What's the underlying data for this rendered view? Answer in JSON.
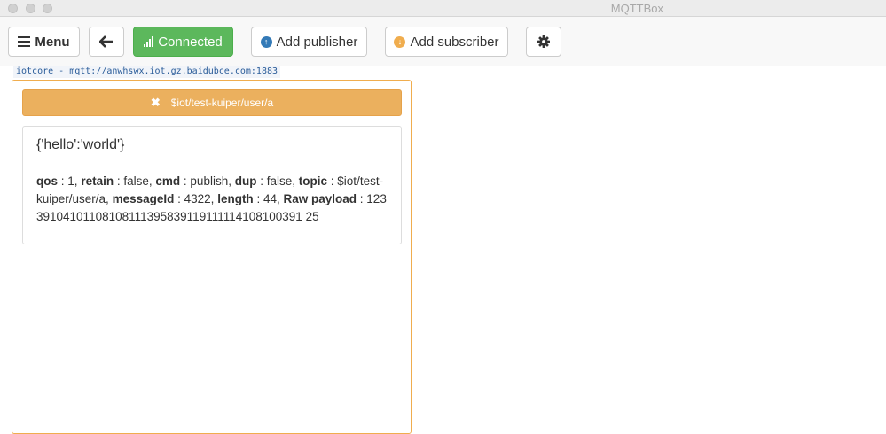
{
  "window": {
    "title": "MQTTBox"
  },
  "toolbar": {
    "menu_label": "Menu",
    "connected_label": "Connected",
    "add_publisher_label": "Add publisher",
    "add_subscriber_label": "Add subscriber"
  },
  "connection": {
    "label": "iotcore - mqtt://anwhswx.iot.gz.baidubce.com:1883"
  },
  "subscriber": {
    "topic": "$iot/test-kuiper/user/a",
    "message": {
      "payload": "{'hello':'world'}",
      "fields": [
        {
          "key": "qos",
          "value": "1"
        },
        {
          "key": "retain",
          "value": "false"
        },
        {
          "key": "cmd",
          "value": "publish"
        },
        {
          "key": "dup",
          "value": "false"
        },
        {
          "key": "topic",
          "value": "$iot/test-kuiper/user/a"
        },
        {
          "key": "messageId",
          "value": "4322"
        },
        {
          "key": "length",
          "value": "44"
        },
        {
          "key": "Raw payload",
          "value": "12339104101108108111395839119111114108100391 25"
        }
      ]
    }
  },
  "colors": {
    "connected": "#5cb85c",
    "topic_bar": "#ebb05e",
    "panel_border": "#f0ad4e",
    "publisher_icon": "#337ab7",
    "subscriber_icon": "#f0ad4e"
  },
  "icons": {
    "menu": "hamburger-icon",
    "back": "arrow-left-icon",
    "connected": "signal-icon",
    "add_publisher": "arrow-circle-up-icon",
    "add_subscriber": "arrow-circle-down-icon",
    "settings": "gear-icon",
    "remove_topic": "close-icon"
  }
}
